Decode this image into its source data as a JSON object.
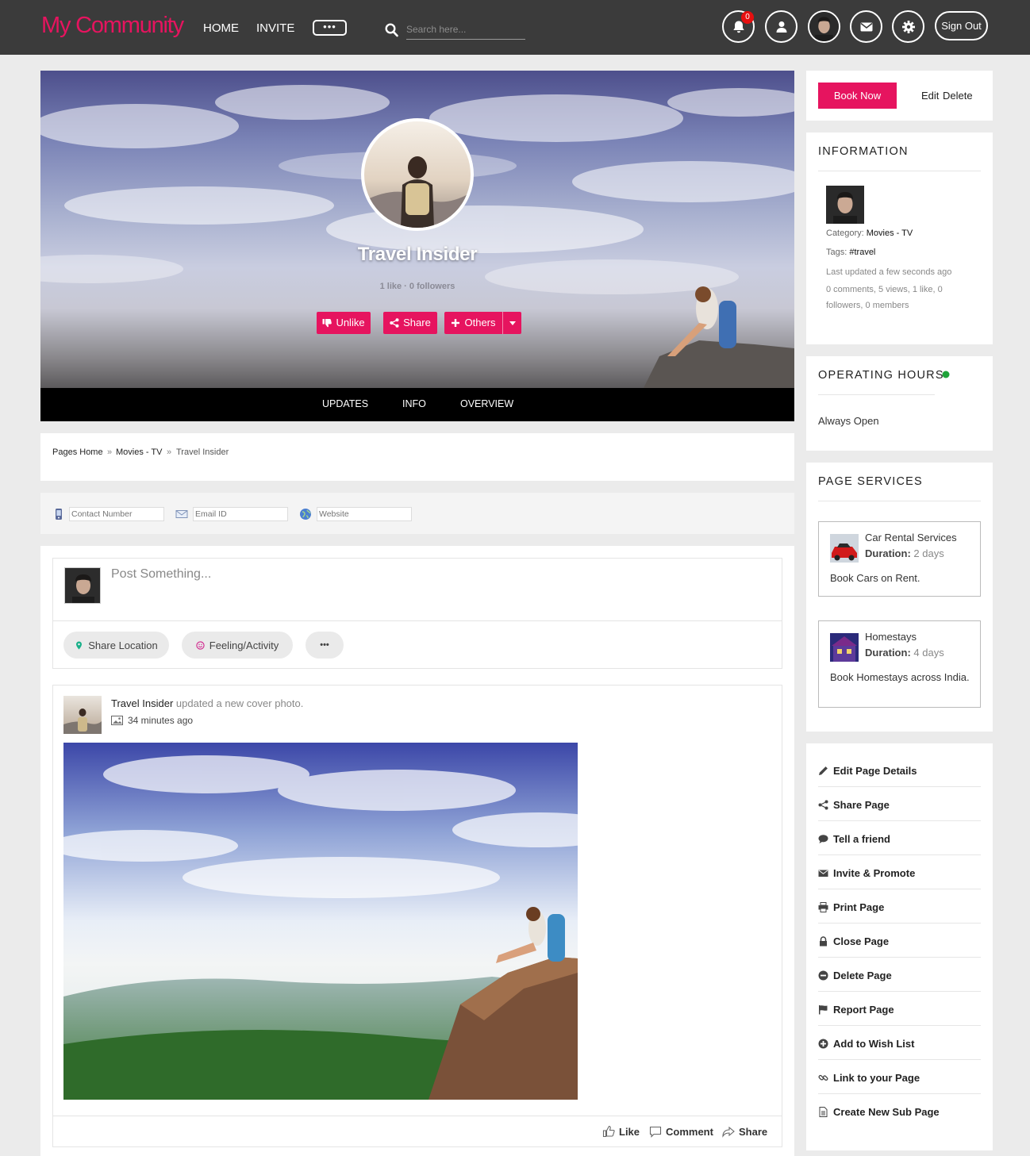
{
  "header": {
    "logo": "My Community",
    "nav": [
      "HOME",
      "INVITE"
    ],
    "more": "•••",
    "search_placeholder": "Search here...",
    "notification_count": "0",
    "sign_out": "Sign Out"
  },
  "cover": {
    "title": "Travel Insider",
    "stats": "1 like · 0 followers",
    "buttons": {
      "unlike": "Unlike",
      "share": "Share",
      "others": "Others"
    }
  },
  "tabs": [
    "UPDATES",
    "INFO",
    "OVERVIEW"
  ],
  "breadcrumb": [
    "Pages Home",
    "Movies - TV",
    "Travel Insider"
  ],
  "contact": {
    "phone_placeholder": "Contact Number",
    "email_placeholder": "Email ID",
    "website_placeholder": "Website"
  },
  "composer": {
    "placeholder": "Post Something...",
    "share_location": "Share Location",
    "feeling": "Feeling/Activity",
    "more": "•••"
  },
  "post": {
    "author": "Travel Insider",
    "action": "updated a new cover photo.",
    "time": "34 minutes ago",
    "like": "Like",
    "comment": "Comment",
    "share": "Share"
  },
  "sidebar": {
    "book_now": "Book Now",
    "edit": "Edit",
    "delete": "Delete",
    "information": {
      "title": "INFORMATION",
      "category_label": "Category:",
      "category": "Movies - TV",
      "tags_label": "Tags:",
      "tags": "#travel",
      "last_updated": "Last updated a few seconds ago",
      "counts_line1": "0 comments, 5 views, 1 like, 0",
      "counts_line2": "followers, 0 members"
    },
    "operating_hours": {
      "title": "OPERATING HOURS",
      "status_color": "#1fa33a",
      "value": "Always Open"
    },
    "page_services": {
      "title": "PAGE SERVICES",
      "duration_label": "Duration:",
      "items": [
        {
          "name": "Car Rental Services",
          "duration": "2 days",
          "description": "Book Cars on Rent."
        },
        {
          "name": "Homestays",
          "duration": "4 days",
          "description": "Book Homestays across India."
        }
      ]
    },
    "actions": [
      {
        "label": "Edit Page Details",
        "icon": "pencil-icon"
      },
      {
        "label": "Share Page",
        "icon": "share-icon"
      },
      {
        "label": "Tell a friend",
        "icon": "chat-bubble-icon"
      },
      {
        "label": "Invite & Promote",
        "icon": "envelope-icon"
      },
      {
        "label": "Print Page",
        "icon": "print-icon"
      },
      {
        "label": "Close Page",
        "icon": "lock-icon"
      },
      {
        "label": "Delete Page",
        "icon": "minus-circle-icon"
      },
      {
        "label": "Report Page",
        "icon": "flag-icon"
      },
      {
        "label": "Add to Wish List",
        "icon": "plus-circle-icon"
      },
      {
        "label": "Link to your Page",
        "icon": "link-icon"
      },
      {
        "label": "Create New Sub Page",
        "icon": "file-icon"
      }
    ]
  },
  "colors": {
    "accent": "#e6145f",
    "topbar": "#3b3b3b",
    "online": "#1fa33a"
  }
}
